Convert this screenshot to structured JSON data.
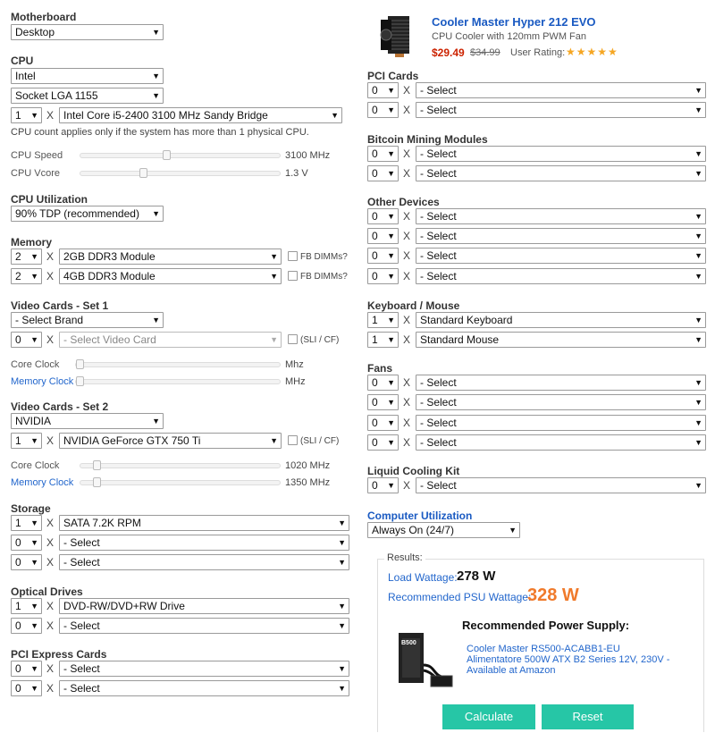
{
  "motherboard": {
    "label": "Motherboard",
    "value": "Desktop"
  },
  "cpu": {
    "label": "CPU",
    "brand": "Intel",
    "socket": "Socket LGA 1155",
    "count": "1",
    "model": "Intel Core i5-2400 3100 MHz Sandy Bridge",
    "note": "CPU count applies only if the system has more than 1 physical CPU.",
    "speed_label": "CPU Speed",
    "speed_value": "3100 MHz",
    "vcore_label": "CPU Vcore",
    "vcore_value": "1.3 V"
  },
  "cpu_utilization": {
    "label": "CPU Utilization",
    "value": "90% TDP (recommended)"
  },
  "memory": {
    "label": "Memory",
    "rows": [
      {
        "qty": "2",
        "module": "2GB DDR3 Module",
        "fb": "FB DIMMs?"
      },
      {
        "qty": "2",
        "module": "4GB DDR3 Module",
        "fb": "FB DIMMs?"
      }
    ]
  },
  "video1": {
    "label": "Video Cards - Set 1",
    "brand": "- Select Brand",
    "qty": "0",
    "card": "- Select Video Card",
    "sli": "(SLI / CF)",
    "core_label": "Core Clock",
    "core_unit": "Mhz",
    "mem_label": "Memory Clock",
    "mem_unit": "MHz"
  },
  "video2": {
    "label": "Video Cards - Set 2",
    "brand": "NVIDIA",
    "qty": "1",
    "card": "NVIDIA GeForce GTX 750 Ti",
    "sli": "(SLI / CF)",
    "core_label": "Core Clock",
    "core_value": "1020 MHz",
    "mem_label": "Memory Clock",
    "mem_value": "1350 MHz"
  },
  "storage": {
    "label": "Storage",
    "rows": [
      {
        "qty": "1",
        "item": "SATA 7.2K RPM"
      },
      {
        "qty": "0",
        "item": "- Select"
      },
      {
        "qty": "0",
        "item": "- Select"
      }
    ]
  },
  "optical": {
    "label": "Optical Drives",
    "rows": [
      {
        "qty": "1",
        "item": "DVD-RW/DVD+RW Drive"
      },
      {
        "qty": "0",
        "item": "- Select"
      }
    ]
  },
  "pcie": {
    "label": "PCI Express Cards",
    "rows": [
      {
        "qty": "0",
        "item": "- Select"
      },
      {
        "qty": "0",
        "item": "- Select"
      }
    ]
  },
  "ad": {
    "title": "Cooler Master Hyper 212 EVO",
    "subtitle": "CPU Cooler with 120mm PWM Fan",
    "price": "$29.49",
    "old_price": "$34.99",
    "rating_label": "User Rating:",
    "stars": "★★★★★"
  },
  "pci": {
    "label": "PCI Cards",
    "rows": [
      {
        "qty": "0",
        "item": "- Select"
      },
      {
        "qty": "0",
        "item": "- Select"
      }
    ]
  },
  "bitcoin": {
    "label": "Bitcoin Mining Modules",
    "rows": [
      {
        "qty": "0",
        "item": "- Select"
      },
      {
        "qty": "0",
        "item": "- Select"
      }
    ]
  },
  "other": {
    "label": "Other Devices",
    "rows": [
      {
        "qty": "0",
        "item": "- Select"
      },
      {
        "qty": "0",
        "item": "- Select"
      },
      {
        "qty": "0",
        "item": "- Select"
      },
      {
        "qty": "0",
        "item": "- Select"
      }
    ]
  },
  "keyboard": {
    "label": "Keyboard / Mouse",
    "rows": [
      {
        "qty": "1",
        "item": "Standard Keyboard"
      },
      {
        "qty": "1",
        "item": "Standard Mouse"
      }
    ]
  },
  "fans": {
    "label": "Fans",
    "rows": [
      {
        "qty": "0",
        "item": "- Select"
      },
      {
        "qty": "0",
        "item": "- Select"
      },
      {
        "qty": "0",
        "item": "- Select"
      },
      {
        "qty": "0",
        "item": "- Select"
      }
    ]
  },
  "liquid": {
    "label": "Liquid Cooling Kit",
    "rows": [
      {
        "qty": "0",
        "item": "- Select"
      }
    ]
  },
  "computer_utilization": {
    "label": "Computer Utilization",
    "value": "Always On (24/7)"
  },
  "results": {
    "legend": "Results:",
    "load_label": "Load Wattage:",
    "load_value": "278 W",
    "psu_label": "Recommended PSU Wattage:",
    "psu_value": "328 W",
    "rec_title": "Recommended Power Supply:",
    "rec_product": "Cooler Master RS500-ACABB1-EU Alimentatore 500W ATX B2 Series 12V, 230V - Available at Amazon",
    "psu_box_text": "B500"
  },
  "buttons": {
    "calculate": "Calculate",
    "reset": "Reset"
  },
  "separator": "X",
  "colors": {
    "accent_button": "#26c6a6",
    "psu_value": "#f07a2b",
    "link": "#2266cc",
    "price": "#cc2200"
  }
}
